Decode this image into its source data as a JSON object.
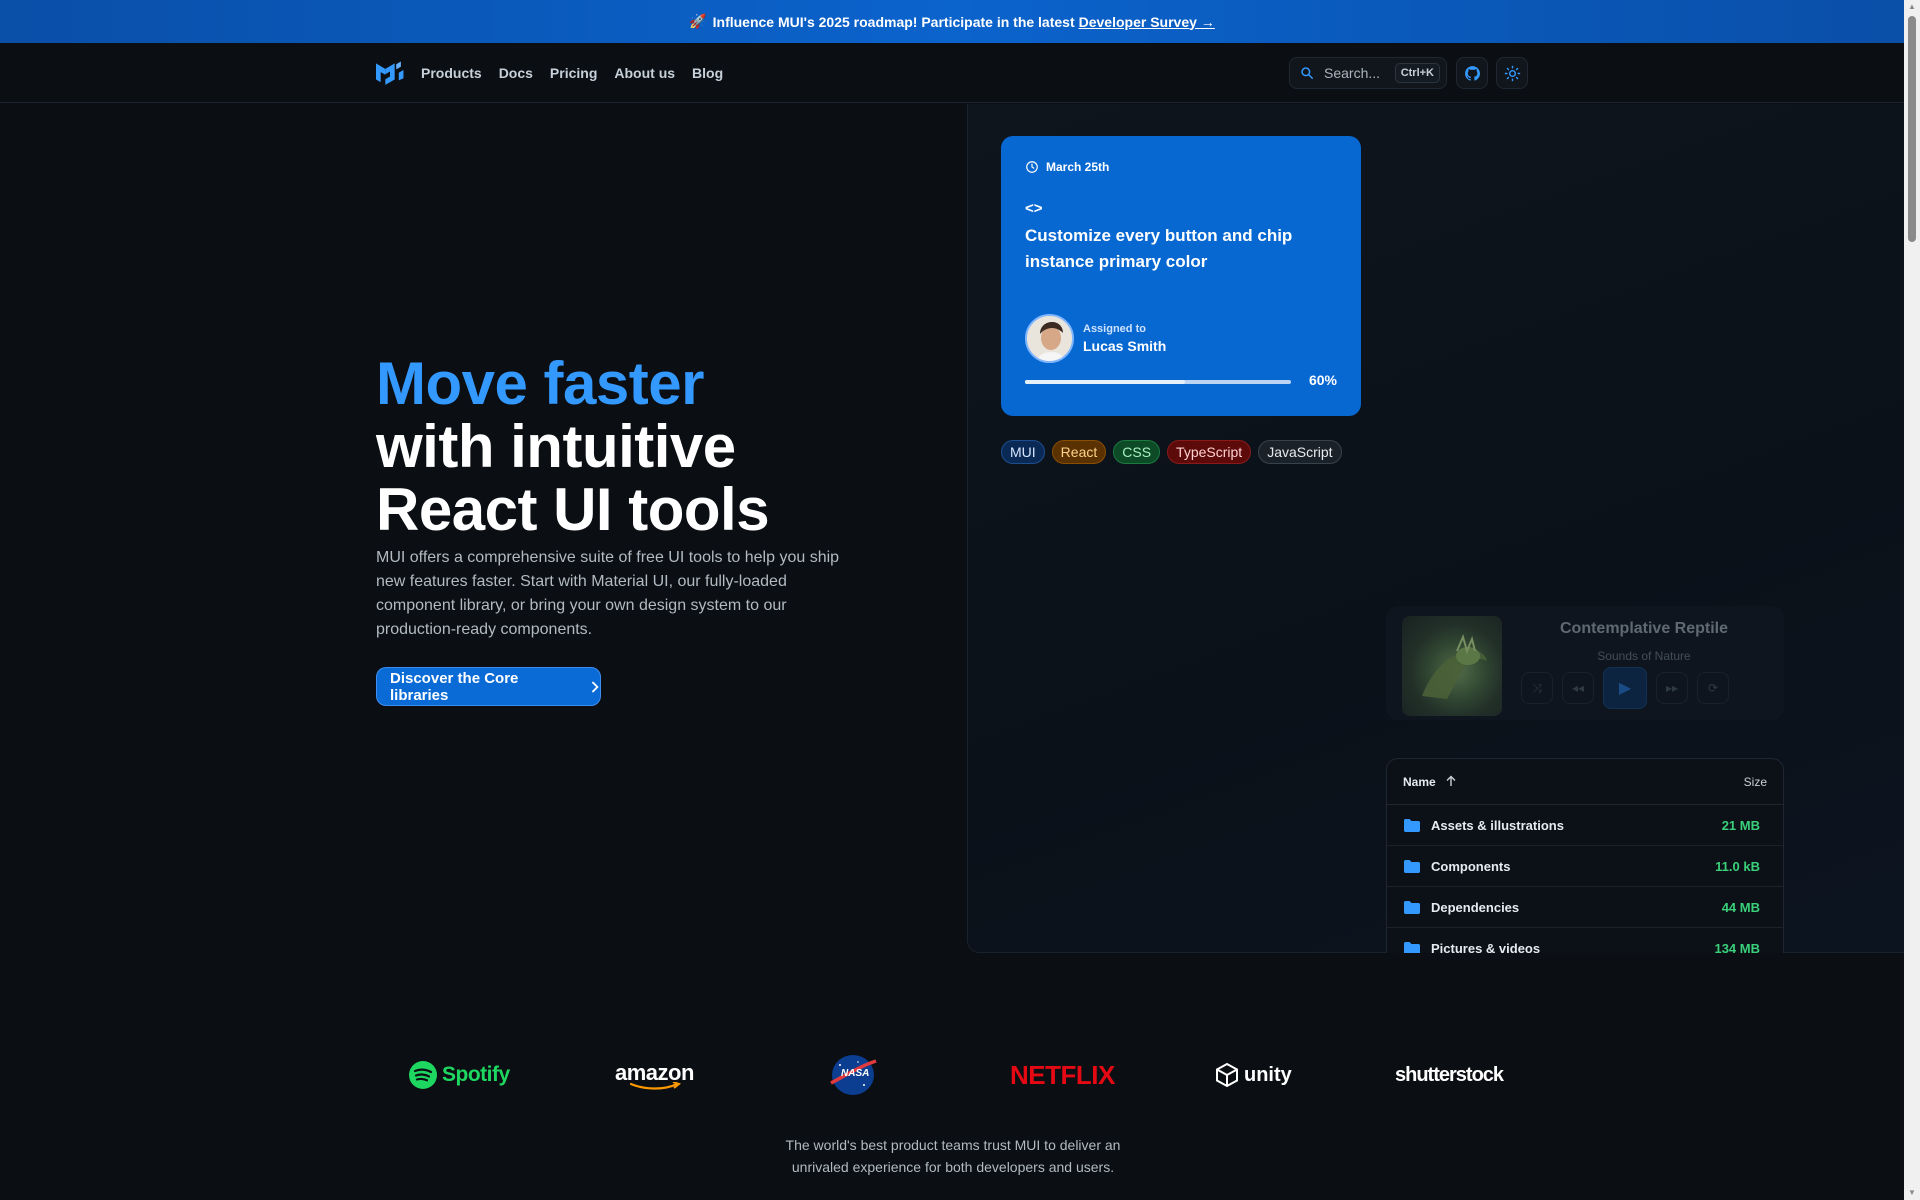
{
  "banner": {
    "text": "Influence MUI's 2025 roadmap! Participate in the latest",
    "link": "Developer Survey →"
  },
  "nav": {
    "items": [
      "Products",
      "Docs",
      "Pricing",
      "About us",
      "Blog"
    ],
    "search_placeholder": "Search...",
    "search_shortcut": "Ctrl+K"
  },
  "hero": {
    "title_accent": "Move faster",
    "title_line2": "with intuitive",
    "title_line3": "React UI tools",
    "description": "MUI offers a comprehensive suite of free UI tools to help you ship new features faster. Start with Material UI, our fully-loaded component library, or bring your own design system to our production-ready components.",
    "cta": "Discover the Core libraries"
  },
  "task_card": {
    "date": "March 25th",
    "code_glyph": "<>",
    "title": "Customize every button and chip instance primary color",
    "assigned_label": "Assigned to",
    "assignee": "Lucas Smith",
    "progress": 0.6,
    "progress_label": "60%"
  },
  "chips": [
    {
      "label": "MUI",
      "bg": "#0a2a55",
      "border": "#1d4e8f",
      "color": "#d6e6ff"
    },
    {
      "label": "React",
      "bg": "#5a3100",
      "border": "#8a4e00",
      "color": "#ffd28a"
    },
    {
      "label": "CSS",
      "bg": "#0d4a26",
      "border": "#1b7a40",
      "color": "#a8f0c4"
    },
    {
      "label": "TypeScript",
      "bg": "#5c0a0a",
      "border": "#8a1a1a",
      "color": "#ffd0d0"
    },
    {
      "label": "JavaScript",
      "bg": "#1b2128",
      "border": "#38424d",
      "color": "#e6ebf1"
    }
  ],
  "player": {
    "track": "Contemplative Reptile",
    "artist": "Sounds of Nature"
  },
  "files": {
    "header_name": "Name",
    "header_size": "Size",
    "rows": [
      {
        "name": "Assets & illustrations",
        "size": "21 MB"
      },
      {
        "name": "Components",
        "size": "11.0 kB"
      },
      {
        "name": "Dependencies",
        "size": "44 MB"
      },
      {
        "name": "Pictures & videos",
        "size": "134 MB"
      }
    ]
  },
  "logos": [
    "Spotify",
    "amazon",
    "NASA",
    "NETFLIX",
    "unity",
    "shutterstock"
  ],
  "trust_text": "The world's best product teams trust MUI to deliver an unrivaled experience for both developers and users.",
  "colors": {
    "accent": "#3399ff",
    "card": "#0868d2",
    "background": "#0b0e12",
    "size_green": "#3ad07a"
  }
}
